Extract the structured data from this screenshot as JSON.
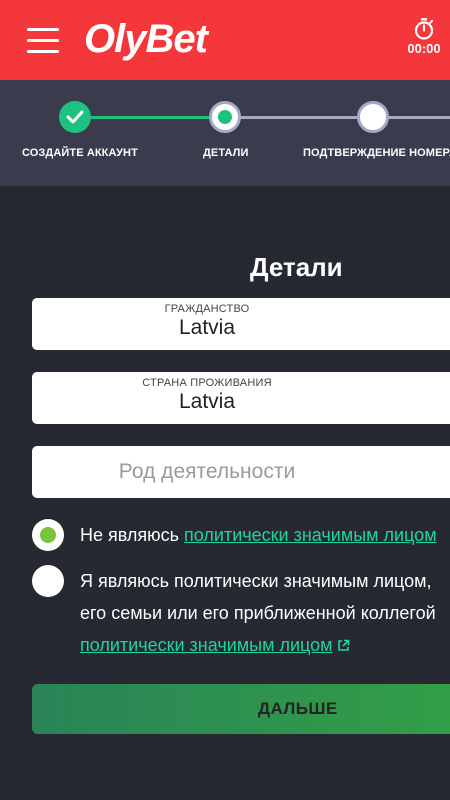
{
  "header": {
    "brand": "OlyBet",
    "timer": "00:00",
    "colors": {
      "background": "#f3373a"
    }
  },
  "stepper": {
    "steps": [
      {
        "label": "СОЗДАЙТЕ АККАУНТ",
        "state": "done"
      },
      {
        "label": "ДЕТАЛИ",
        "state": "active"
      },
      {
        "label": "ПОДТВЕРЖДЕНИЕ НОМЕРА",
        "state": "pending"
      }
    ],
    "colors": {
      "done": "#1dc281",
      "pending": "#a7a8c4"
    }
  },
  "form": {
    "title": "Детали",
    "citizenship": {
      "caption": "ГРАЖДАНСТВО",
      "value": "Latvia"
    },
    "residence": {
      "caption": "СТРАНА ПРОЖИВАНИЯ",
      "value": "Latvia"
    },
    "occupation": {
      "placeholder": "Род деятельности"
    },
    "pep_no": {
      "prefix": "Не являюсь ",
      "link": "политически значимым лицом",
      "checked": true
    },
    "pep_yes": {
      "line1": "Я являюсь политически значимым лицом,",
      "line2": "его семьи или его приближенной коллегой",
      "link": "политически значимым лицом",
      "checked": false
    },
    "next_label": "ДАЛЬШЕ"
  }
}
